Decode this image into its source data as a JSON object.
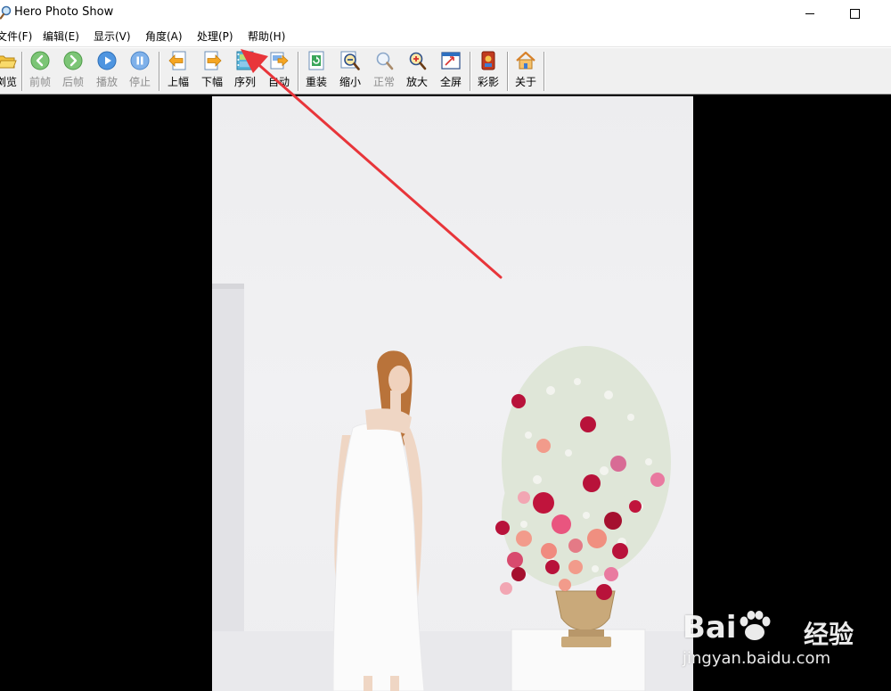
{
  "window": {
    "title": "Hero Photo Show",
    "minimize": "minimize",
    "maximize": "maximize"
  },
  "menu": [
    {
      "label": "文件(F)"
    },
    {
      "label": "编辑(E)"
    },
    {
      "label": "显示(V)"
    },
    {
      "label": "角度(A)"
    },
    {
      "label": "处理(P)"
    },
    {
      "label": "帮助(H)"
    }
  ],
  "toolbar": {
    "browse": "浏览",
    "prev_frame": "前帧",
    "next_frame": "后帧",
    "play": "播放",
    "stop": "停止",
    "prev_image": "上幅",
    "next_image": "下幅",
    "sequence": "序列",
    "auto": "自动",
    "reload": "重装",
    "zoom_out": "缩小",
    "normal": "正常",
    "zoom_in": "放大",
    "fullscreen": "全屏",
    "color": "彩影",
    "about": "关于"
  },
  "icons": {
    "browse": "folder-open-icon",
    "prev_frame": "green-left-arrow-icon",
    "next_frame": "green-right-arrow-icon",
    "play": "blue-play-icon",
    "stop": "blue-pause-icon",
    "prev_image": "page-left-arrow-icon",
    "next_image": "page-right-arrow-icon",
    "sequence": "film-strip-icon",
    "auto": "auto-slideshow-icon",
    "reload": "reload-icon",
    "zoom_out": "magnifier-minus-icon",
    "normal": "magnifier-icon",
    "zoom_in": "magnifier-plus-icon",
    "fullscreen": "fullscreen-icon",
    "color": "color-film-icon",
    "about": "house-icon"
  },
  "colors": {
    "accent_arrow": "#e8353a",
    "viewer_bg": "#000000",
    "toolbar_bg": "#f0f0f0"
  },
  "watermark": {
    "brand": "Bai",
    "brand_suffix": "du",
    "cn": "经验",
    "url": "jingyan.baidu.com"
  }
}
